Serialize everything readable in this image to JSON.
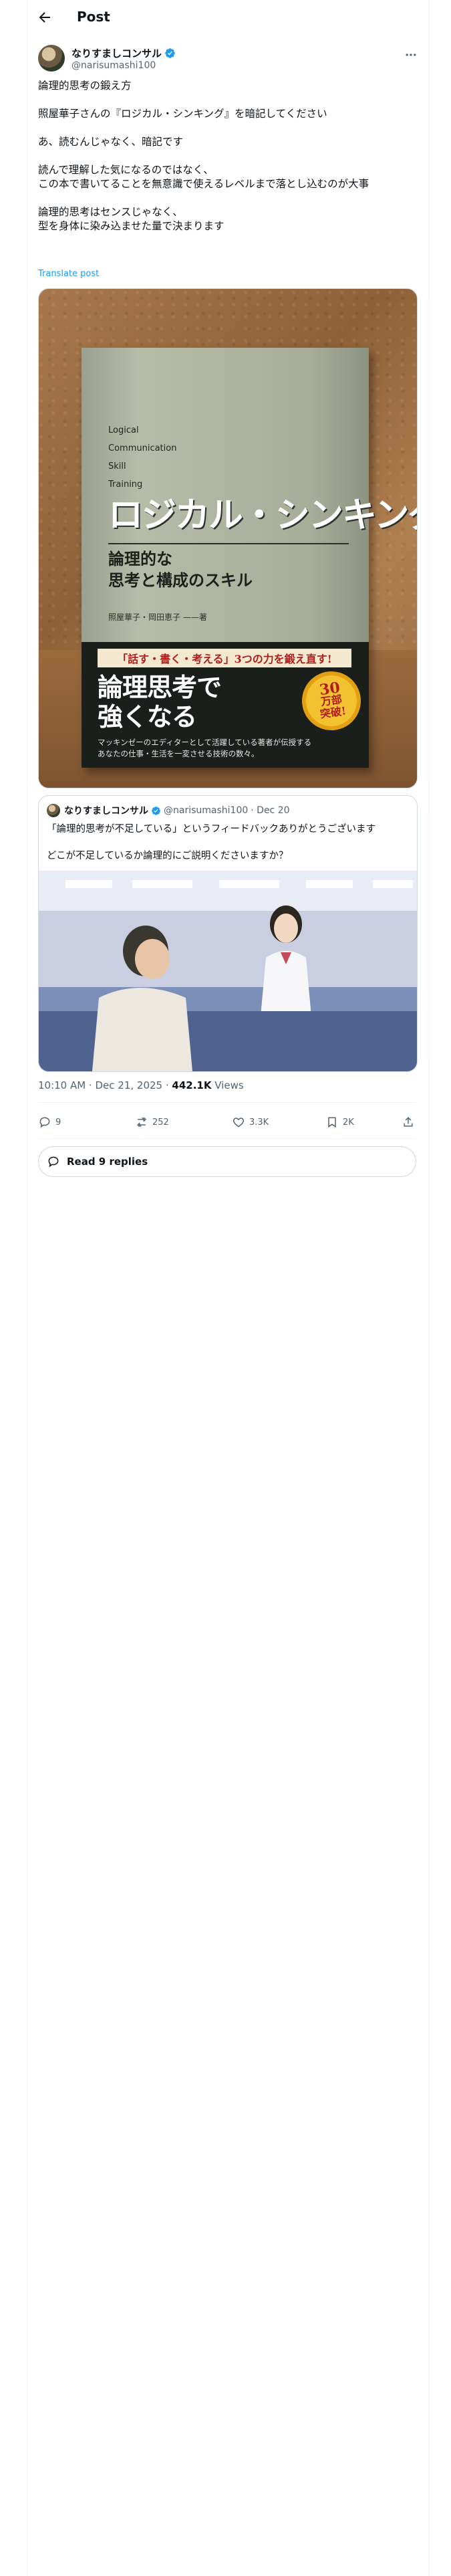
{
  "header": {
    "title": "Post"
  },
  "author": {
    "name": "なりすましコンサル",
    "handle": "@narisumashi100"
  },
  "tweet": {
    "lines": [
      "論理的思考の鍛え方",
      "照屋華子さんの『ロジカル・シンキング』を暗記してください",
      "あ、読むんじゃなく、暗記です",
      "読んで理解した気になるのではなく、",
      "この本で書いてることを無意識で使えるレベルまで落とし込むのが大事",
      "論理的思考はセンスじゃなく、",
      "型を身体に染み込ませた量で決まります"
    ],
    "translate_label": "Translate post"
  },
  "book_cover": {
    "english_lines": [
      "Logical",
      "Communication",
      "Skill",
      "Training"
    ],
    "title": "ロジカル・シンキング",
    "subtitle_lines": [
      "論理的な",
      "思考と構成のスキル"
    ],
    "authors": "照屋華子・岡田恵子 ——著",
    "tagline": "「話す・書く・考える」3つの力を鍛え直す!",
    "headline_lines": [
      "論理思考で",
      "強くなる"
    ],
    "description_lines": [
      "マッキンゼーのエディターとして活躍している著者が伝授する",
      "あなたの仕事・生活を一変させる技術の数々。"
    ],
    "badge_lines": [
      "30",
      "万部",
      "突破!"
    ]
  },
  "quoted": {
    "name": "なりすましコンサル",
    "handle": "@narisumashi100",
    "date": "· Dec 20",
    "lines": [
      "「論理的思考が不足している」というフィードバックありがとうございます",
      "どこが不足しているか論理的にご説明くださいますか？"
    ]
  },
  "meta": {
    "time": "10:10 AM · Dec 21, 2025 · ",
    "views_count": "442.1K",
    "views_label": " Views"
  },
  "actions": {
    "replies": "9",
    "reposts": "252",
    "likes": "3.3K",
    "bookmarks": "2K"
  },
  "read_replies": "Read 9 replies",
  "colors": {
    "accent": "#1d9bf0",
    "text": "#0f1419",
    "muted": "#536471",
    "border": "#cfd9de"
  }
}
